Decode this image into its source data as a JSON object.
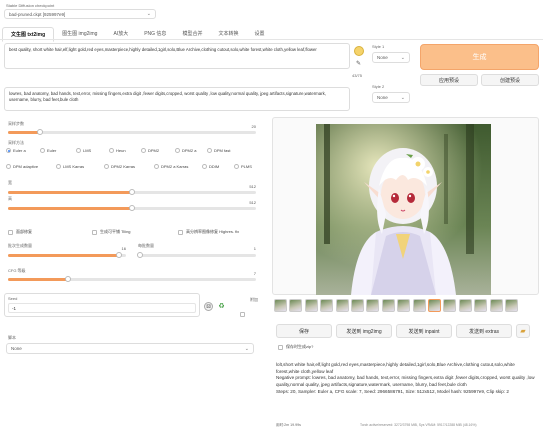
{
  "checkpoint": {
    "label": "Stable Diffusion checkpoint",
    "value": "bad-pruned.ckpt [925997e9]"
  },
  "tabs": [
    {
      "label": "文生图 txt2img",
      "active": true
    },
    {
      "label": "图生图 img2img",
      "active": false
    },
    {
      "label": "AI放大",
      "active": false
    },
    {
      "label": "PNG 信息",
      "active": false
    },
    {
      "label": "模型合并",
      "active": false
    },
    {
      "label": "文本转换",
      "active": false
    },
    {
      "label": "设置",
      "active": false
    }
  ],
  "prompt": {
    "positive": "best quality, short white hair,elf,light gold,red eyes,masterpiece,highly detailed,1girl,solo,Blue Archive,clothing cutout,solo,white forest,white cloth,yellow leaf,flower",
    "negative": "lowres, bad anatomy, bad hands, text,error, missing fingers,extra digit ,fewer digits,cropped, worst quality ,low quality,normal quality, jpeg artifacts,signature,watermark, username, blurry, bad feet,bule cloth",
    "token_count": "43/75"
  },
  "styles": {
    "style1_label": "Style 1",
    "style1_value": "None",
    "style2_label": "Style 2",
    "style2_value": "None"
  },
  "buttons": {
    "generate": "生成",
    "apply_preset": "应用预设",
    "create_preset": "创建预设"
  },
  "sampling": {
    "steps_label": "采样步数",
    "steps_value": "20",
    "steps_fraction": 0.13,
    "method_label": "采样方法",
    "methods": [
      "Euler a",
      "Euler",
      "LMS",
      "Heun",
      "DPM2",
      "DPM2 a",
      "DPM fast",
      "DPM adaptive",
      "LMS Karras",
      "DPM2 Karras",
      "DPM2 a Karras",
      "DDIM",
      "PLMS"
    ],
    "selected_method": "Euler a"
  },
  "size": {
    "width_label": "宽",
    "width_value": "512",
    "height_label": "高",
    "height_value": "512",
    "width_fraction": 0.5,
    "height_fraction": 0.5
  },
  "options": {
    "restore_faces": "面部修复",
    "tiling": "生成可平铺 Tiling",
    "highres": "高分辨率图像修复 Highres. fix"
  },
  "batch": {
    "count_label": "批次生成数量",
    "count_value": "16",
    "count_fraction": 0.94,
    "size_label": "每批数量",
    "size_value": "1",
    "size_fraction": 0.02
  },
  "cfg": {
    "label": "CFG 等级",
    "value": "7",
    "fraction": 0.24
  },
  "seed": {
    "label": "Seed",
    "value": "-1",
    "extra_label": "附加"
  },
  "script": {
    "label": "脚本",
    "value": "None"
  },
  "output": {
    "actions": [
      "保存",
      "发送到 img2img",
      "发送到 inpaint",
      "发送到 extras"
    ],
    "save_zip_label": "保存时生成zip?",
    "info_prompt": "lolt,short white hair,elf,light gold,red eyes,masterpiece,highly detailed,1girl,solo,Blue Archive,clothing cutout,solo,white forest,white cloth,yellow leaf",
    "info_negative": "Negative prompt: lowres, bad anatomy, bad hands, text,error, missing fingers,extra digit ,fewer digits,cropped, worst quality ,low quality,normal quality, jpeg artifacts,signature,watermark, username, blurry, bad feet,bule cloth",
    "info_params": "Steps: 20, Sampler: Euler a, CFG scale: 7, Seed: 2966586791, Size: 512x512, Model hash: 925997e9, Clip skip: 2",
    "footer_left": "用时:2m 19.99s",
    "footer_right": "Torch active/reserved: 3272/3798 MiB, Sys VRAM: 5917/12288 MiB (48.16%)"
  },
  "colors": {
    "accent": "#f39a5a",
    "generate_bg": "#fbbf8a"
  }
}
